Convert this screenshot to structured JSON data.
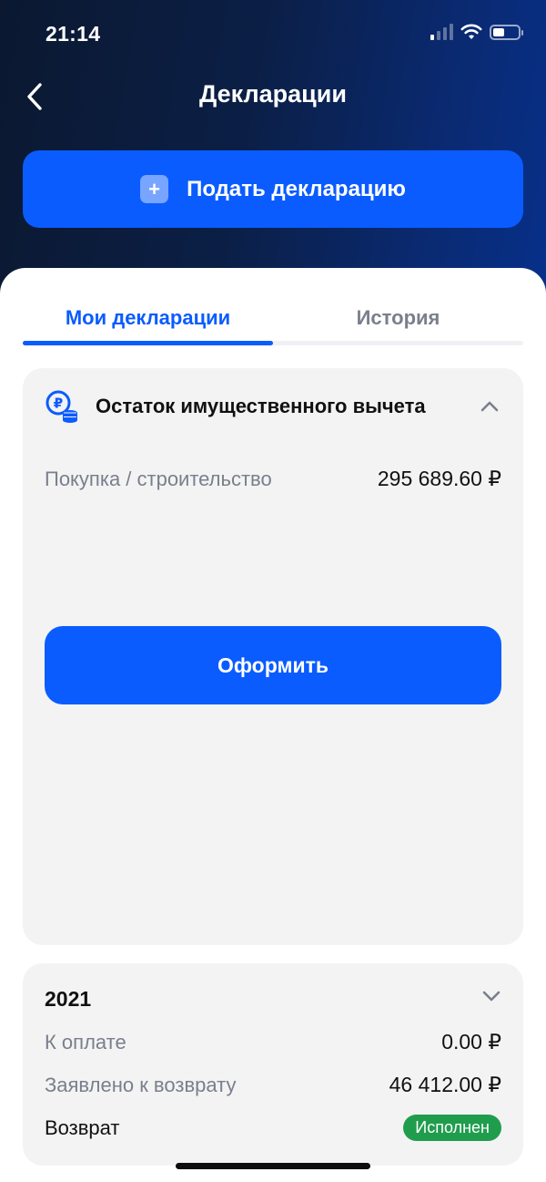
{
  "status_bar": {
    "time": "21:14",
    "icons": [
      "signal-icon",
      "wifi-icon",
      "battery-icon"
    ]
  },
  "header": {
    "title": "Декларации",
    "back_icon": "chevron-left-icon"
  },
  "primary_action": {
    "label": "Подать декларацию",
    "icon": "plus-icon"
  },
  "tabs": [
    {
      "label": "Мои декларации",
      "active": true
    },
    {
      "label": "История",
      "active": false
    }
  ],
  "deduction_card": {
    "title": "Остаток имущественного вычета",
    "icon": "ruble-coins-icon",
    "expanded": true,
    "rows": [
      {
        "label": "Покупка / строительство",
        "value": "295 689.60 ₽"
      }
    ],
    "button_label": "Оформить"
  },
  "year_card": {
    "year": "2021",
    "expanded": false,
    "rows": [
      {
        "label": "К оплате",
        "value": "0.00 ₽"
      },
      {
        "label": "Заявлено к возврату",
        "value": "46 412.00 ₽"
      },
      {
        "label": "Возврат",
        "status": "Исполнен"
      }
    ]
  },
  "colors": {
    "accent": "#0a5cff",
    "success": "#1f9d4d",
    "card_bg": "#f3f3f3",
    "muted_text": "#7a7f8c"
  }
}
